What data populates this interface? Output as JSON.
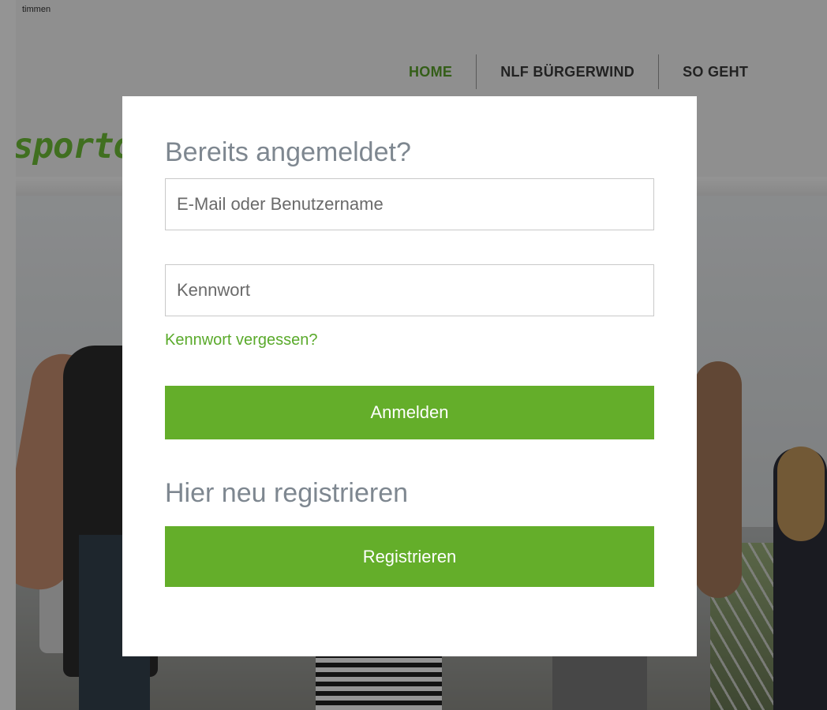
{
  "site": {
    "topbar_text": "timmen",
    "brand": "sporto",
    "nav": [
      {
        "label": "HOME",
        "active": true
      },
      {
        "label": "NLF BÜRGERWIND",
        "active": false
      },
      {
        "label": "SO GEHT",
        "active": false
      }
    ]
  },
  "login_modal": {
    "title": "Bereits angemeldet?",
    "email_placeholder": "E-Mail oder Benutzername",
    "password_placeholder": "Kennwort",
    "forgot_link": "Kennwort vergessen?",
    "login_button": "Anmelden",
    "register_heading": "Hier neu registrieren",
    "register_button": "Registrieren"
  },
  "colors": {
    "accent_green": "#64ae2a",
    "heading_gray": "#7e8790",
    "overlay": "rgba(0,0,0,0.42)"
  }
}
